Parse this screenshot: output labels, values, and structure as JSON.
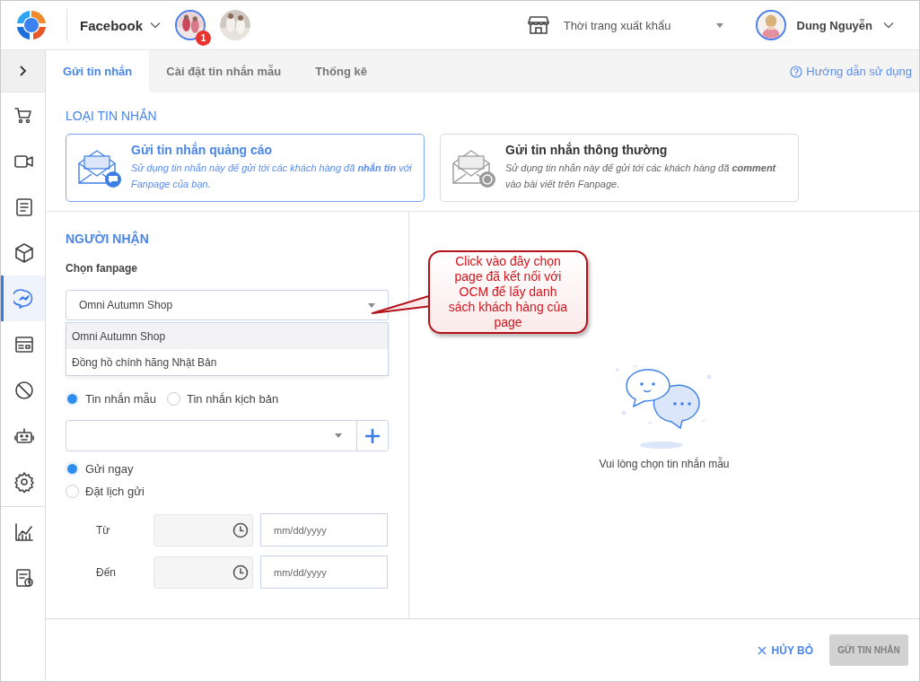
{
  "header": {
    "app_switcher": "Facebook",
    "page_avatars": [
      {
        "badge": "1",
        "selected": true
      },
      {
        "selected": false
      }
    ],
    "store": "Thời trang xuất khẩu",
    "user": "Dung Nguyễn"
  },
  "sidebar": {
    "items": [
      {
        "kind": "cart",
        "selected": false
      },
      {
        "kind": "video",
        "selected": false
      },
      {
        "kind": "document",
        "selected": false
      },
      {
        "kind": "box",
        "selected": false
      },
      {
        "kind": "messenger",
        "selected": true
      },
      {
        "kind": "card",
        "selected": false
      },
      {
        "kind": "ban",
        "selected": false
      },
      {
        "kind": "robot",
        "selected": false
      },
      {
        "kind": "gear",
        "selected": false
      },
      {
        "kind": "chart",
        "selected": false
      },
      {
        "kind": "report",
        "selected": false
      }
    ]
  },
  "tabs": [
    {
      "label": "Gửi tin nhắn",
      "selected": true
    },
    {
      "label": "Cài đặt tin nhắn mẫu",
      "selected": false
    },
    {
      "label": "Thống kê",
      "selected": false
    }
  ],
  "help_link": "Hướng dẫn sử dụng",
  "message_type": {
    "title": "LOẠI TIN NHẮN",
    "options": [
      {
        "kind": "ad",
        "title": "Gửi tin nhắn quảng cáo",
        "description": "Sử dụng tin nhắn này để gửi tới các khách hàng đã **nhắn tin** với Fanpage của bạn.",
        "selected": true
      },
      {
        "kind": "comment",
        "title": "Gửi tin nhắn thông thường",
        "description": "Sử dụng tin nhắn này để gửi tới các khách hàng đã **comment** vào bài viết trên Fanpage.",
        "selected": false
      }
    ]
  },
  "recipient": {
    "title": "NGƯỜI NHẬN",
    "fanpage_label": "Chọn fanpage",
    "fanpage_value": "Omni Autumn Shop",
    "fanpage_options": [
      {
        "label": "Omni Autumn Shop",
        "selected": true
      },
      {
        "label": "Đồng hồ chính hãng Nhật Bản",
        "selected": false
      }
    ],
    "message_source": [
      {
        "label": "Tin nhắn mẫu",
        "selected": true
      },
      {
        "label": "Tin nhắn kịch bản",
        "selected": false
      }
    ],
    "schedule": [
      {
        "label": "Gửi ngay",
        "selected": true
      },
      {
        "label": "Đặt lịch gửi",
        "selected": false
      }
    ],
    "range": [
      {
        "label": "Từ",
        "date_placeholder": "mm/dd/yyyy"
      },
      {
        "label": "Đến",
        "date_placeholder": "mm/dd/yyyy"
      }
    ]
  },
  "preview": {
    "empty_text": "Vui lòng chọn tin nhắn mẫu"
  },
  "callout": {
    "text": "Click vào đây chọn page đã kết nối với OCM để lấy danh sách khách hàng của page"
  },
  "footer": {
    "cancel": "HỦY BỎ",
    "submit": {
      "label": "GỬI TIN NHẮN",
      "disabled": true
    }
  }
}
